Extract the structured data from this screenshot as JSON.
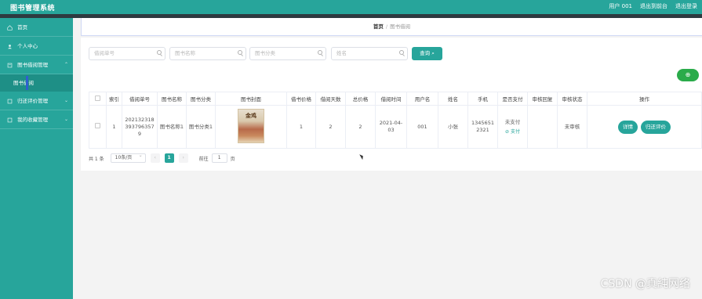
{
  "app": {
    "title": "图书管理系统",
    "user_label": "用户 001",
    "back_label": "退出到前台",
    "logout_label": "退出登录"
  },
  "sidebar": {
    "items": [
      {
        "label": "首页",
        "icon": "home-icon"
      },
      {
        "label": "个人中心",
        "icon": "user-icon"
      },
      {
        "label": "图书借阅管理",
        "icon": "book-icon"
      },
      {
        "label": "图书借阅",
        "icon": ""
      },
      {
        "label": "归还评价管理",
        "icon": "comment-icon"
      },
      {
        "label": "我的收藏管理",
        "icon": "star-icon"
      }
    ]
  },
  "breadcrumb": {
    "home": "首页",
    "separator": "/",
    "current": "图书借阅"
  },
  "search": {
    "borrow_no_placeholder": "借阅单号",
    "book_name_placeholder": "图书名称",
    "book_category_placeholder": "图书分类",
    "name_placeholder": "姓名",
    "search_button": "查询"
  },
  "add_button": "⊕",
  "table": {
    "headers": [
      "",
      "索引",
      "借阅单号",
      "图书名称",
      "图书分类",
      "图书封面",
      "借书价格",
      "借阅天数",
      "总价格",
      "借阅时间",
      "用户名",
      "姓名",
      "手机",
      "是否支付",
      "审核回复",
      "审核状态",
      "操作"
    ],
    "rows": [
      {
        "index": "1",
        "borrow_no": "2021323183937963579",
        "book_name": "图书名称1",
        "category": "图书分类1",
        "cover_text": "金鸡",
        "price": "1",
        "days": "2",
        "total": "2",
        "borrow_time": "2021-04-03",
        "username": "001",
        "name": "小张",
        "phone": "13456512321",
        "paid": "未支付",
        "pay_link": "⊘ 支付",
        "reply": "",
        "status": "未审核",
        "actions": [
          "详情",
          "归还评价"
        ]
      }
    ]
  },
  "pager": {
    "total": "共 1 条",
    "page_size": "10条/页",
    "prev": "‹",
    "current": "1",
    "next": "›",
    "goto_prefix": "前往",
    "goto_value": "1",
    "goto_suffix": "页"
  },
  "watermark": "CSDN @真純网络",
  "colors": {
    "brand": "#27a59b",
    "add_button": "#2aab4a",
    "dark_band": "#2e3a40"
  }
}
